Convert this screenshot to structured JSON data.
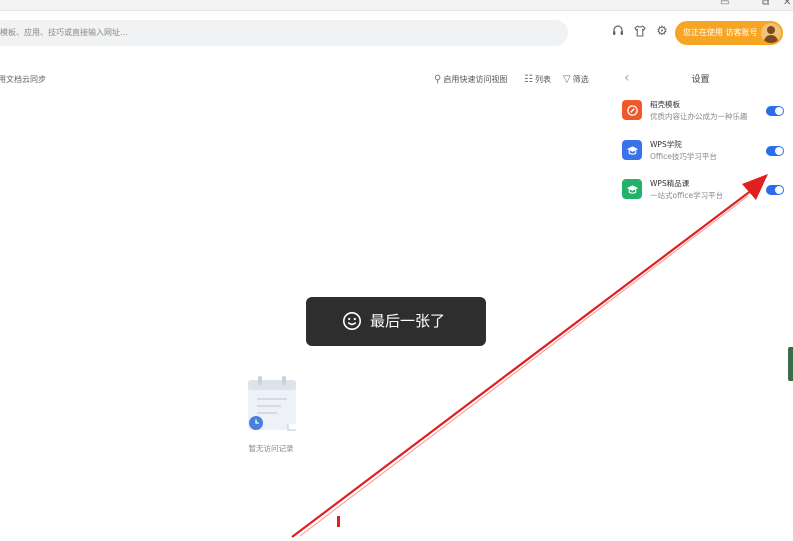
{
  "search": {
    "placeholder_text": "模板、应用、技巧或直接输入网址..."
  },
  "header": {
    "user_button_label": "您正在使用 访客账号",
    "icons": [
      "headset-icon",
      "shirt-icon",
      "gear-icon"
    ]
  },
  "main": {
    "cloud_sync_text": "用文档云同步",
    "toolbar": {
      "quick_access_label": "启用快速访问视图",
      "list_label": "列表",
      "filter_label": "筛选"
    },
    "empty_state_text": "暂无访问记录"
  },
  "settings_panel": {
    "title": "设置",
    "items": [
      {
        "name": "稻壳模板",
        "desc": "优质内容让办公成为一种乐趣",
        "icon": "docer-icon",
        "color": "#f0582a",
        "enabled": true
      },
      {
        "name": "WPS学院",
        "desc": "Office技巧学习平台",
        "icon": "graduation-cap-icon",
        "color": "#3a73e8",
        "enabled": true
      },
      {
        "name": "WPS精品课",
        "desc": "一站式office学习平台",
        "icon": "course-cap-icon",
        "color": "#24b26a",
        "enabled": true
      }
    ]
  },
  "toast": {
    "message": "最后一张了",
    "icon": "smiley-icon"
  },
  "colors": {
    "accent_orange": "#f7a524",
    "toggle_blue": "#2b6de8",
    "annotation_red": "#e02020",
    "toast_bg": "#2e2e2e"
  }
}
